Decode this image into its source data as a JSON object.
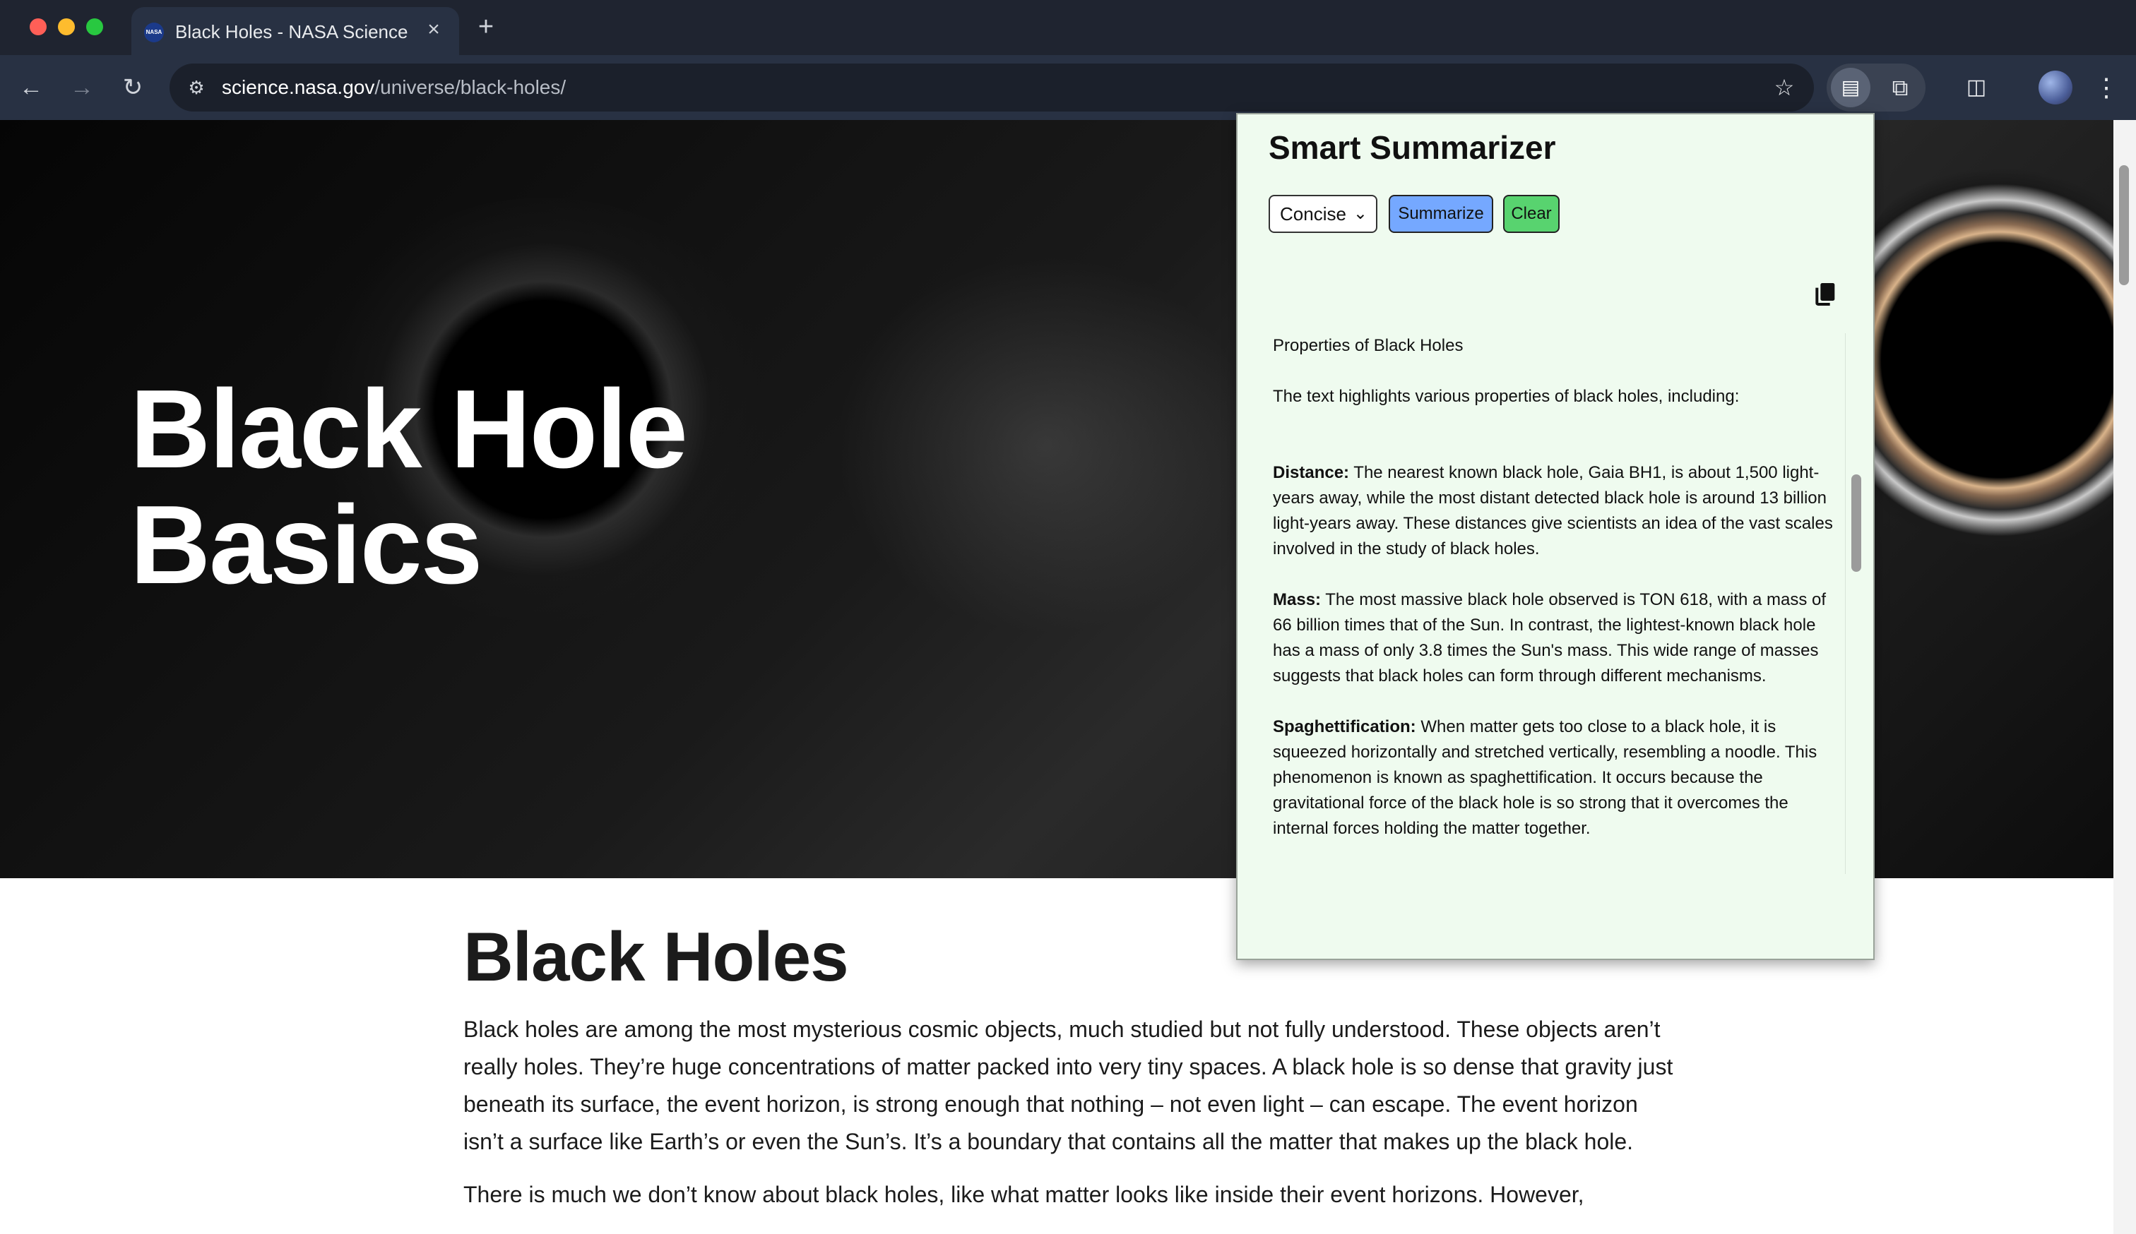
{
  "browser": {
    "tab": {
      "favicon": "NASA",
      "title": "Black Holes - NASA Science",
      "close": "×"
    },
    "new_tab": "+",
    "nav": {
      "back": "←",
      "forward": "→",
      "reload": "↻"
    },
    "site_info": "⚙",
    "url": {
      "host": "science.nasa.gov",
      "path": "/universe/black-holes/"
    },
    "bookmark": "☆",
    "extension_active": "▤",
    "extensions": "⧉",
    "side_panel": "◫",
    "menu": "⋮"
  },
  "hero": {
    "title_line1": "Black Hole",
    "title_line2": "Basics"
  },
  "article": {
    "title": "Black Holes",
    "p1": "Black holes are among the most mysterious cosmic objects, much studied but not fully understood. These objects aren’t really holes. They’re huge concentrations of matter packed into very tiny spaces. A black hole is so dense that gravity just beneath its surface, the event horizon, is strong enough that nothing – not even light – can escape. The event horizon isn’t a surface like Earth’s or even the Sun’s. It’s a boundary that contains all the matter that makes up the black hole.",
    "p2": "There is much we don’t know about black holes, like what matter looks like inside their event horizons. However,"
  },
  "summarizer": {
    "title": "Smart Summarizer",
    "style_value": "Concise",
    "summarize_label": "Summarize",
    "clear_label": "Clear",
    "summary": {
      "heading": "Properties of Black Holes",
      "intro": "The text highlights various properties of black holes, including:",
      "items": [
        {
          "term": "Distance:",
          "text": " The nearest known black hole, Gaia BH1, is about 1,500 light-years away, while the most distant detected black hole is around 13 billion light-years away. These distances give scientists an idea of the vast scales involved in the study of black holes."
        },
        {
          "term": "Mass:",
          "text": " The most massive black hole observed is TON 618, with a mass of 66 billion times that of the Sun. In contrast, the lightest-known black hole has a mass of only 3.8 times the Sun's mass. This wide range of masses suggests that black holes can form through different mechanisms."
        },
        {
          "term": "Spaghettification:",
          "text": " When matter gets too close to a black hole, it is squeezed horizontally and stretched vertically, resembling a noodle. This phenomenon is known as spaghettification. It occurs because the gravitational force of the black hole is so strong that it overcomes the internal forces holding the matter together."
        }
      ]
    }
  },
  "colors": {
    "chrome_dark": "#1f2430",
    "toolbar": "#283143",
    "popup_bg": "#effbef",
    "summarize_btn": "#75a8ff",
    "clear_btn": "#58d36f"
  },
  "icons": [
    "nasa-favicon-icon",
    "close-icon",
    "plus-icon",
    "back-arrow-icon",
    "forward-arrow-icon",
    "reload-icon",
    "site-settings-icon",
    "star-icon",
    "summarizer-extension-icon",
    "puzzle-icon",
    "side-panel-icon",
    "menu-dots-icon",
    "copy-icon",
    "chevron-down-icon"
  ]
}
